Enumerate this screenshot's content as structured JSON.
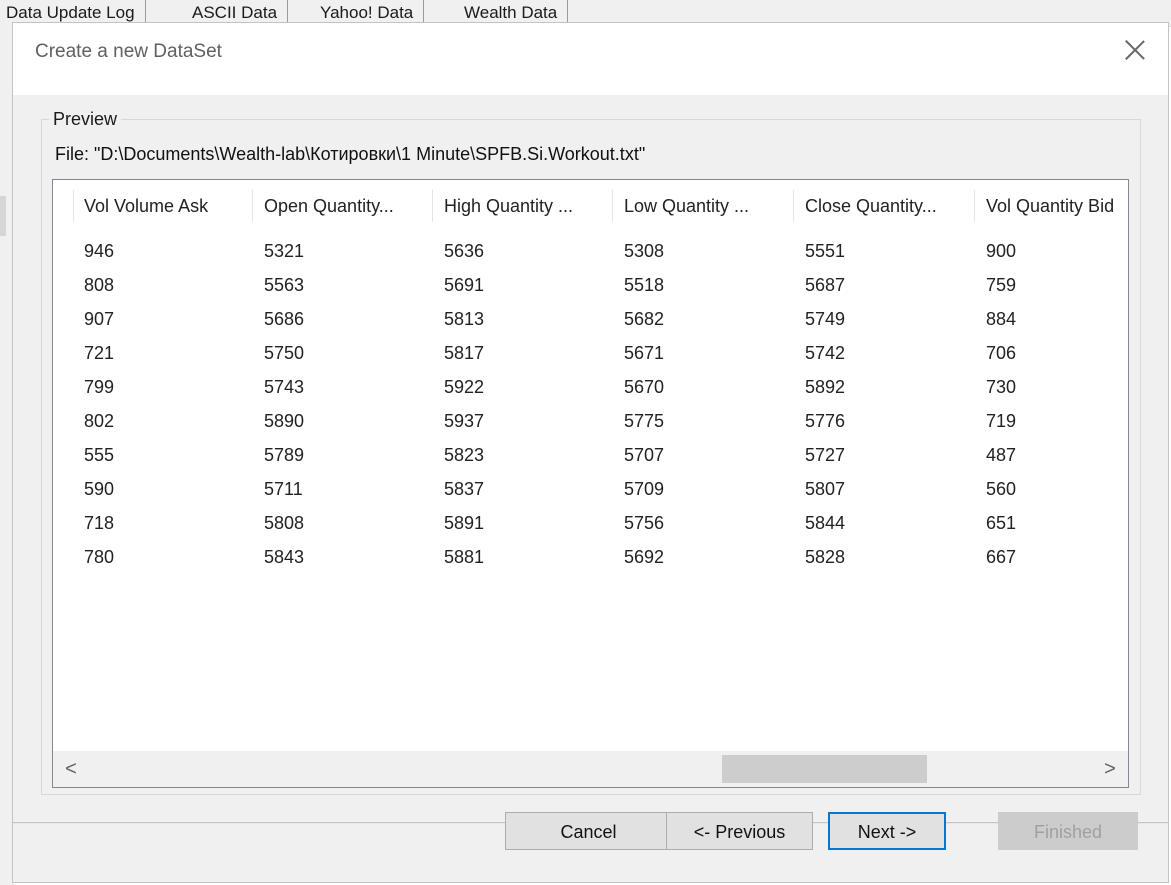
{
  "background_tabs": [
    "Data Update Log",
    "ASCII Data",
    "Yahoo! Data",
    "Wealth Data"
  ],
  "dialog": {
    "title": "Create a new DataSet",
    "close_label": "✕"
  },
  "preview": {
    "group_label": "Preview",
    "file_label": "File: \"D:\\Documents\\Wealth-lab\\Котировки\\1 Minute\\SPFB.Si.Workout.txt\""
  },
  "table": {
    "columns": [
      "Vol Volume Ask",
      "Open Quantity...",
      "High Quantity ...",
      "Low Quantity ...",
      "Close Quantity...",
      "Vol Quantity Bid"
    ],
    "rows": [
      [
        "946",
        "5321",
        "5636",
        "5308",
        "5551",
        "900"
      ],
      [
        "808",
        "5563",
        "5691",
        "5518",
        "5687",
        "759"
      ],
      [
        "907",
        "5686",
        "5813",
        "5682",
        "5749",
        "884"
      ],
      [
        "721",
        "5750",
        "5817",
        "5671",
        "5742",
        "706"
      ],
      [
        "799",
        "5743",
        "5922",
        "5670",
        "5892",
        "730"
      ],
      [
        "802",
        "5890",
        "5937",
        "5775",
        "5776",
        "719"
      ],
      [
        "555",
        "5789",
        "5823",
        "5707",
        "5727",
        "487"
      ],
      [
        "590",
        "5711",
        "5837",
        "5709",
        "5807",
        "560"
      ],
      [
        "718",
        "5808",
        "5891",
        "5756",
        "5844",
        "651"
      ],
      [
        "780",
        "5843",
        "5881",
        "5692",
        "5828",
        "667"
      ]
    ],
    "scroll_left_glyph": "<",
    "scroll_right_glyph": ">"
  },
  "buttons": {
    "cancel": "Cancel",
    "previous": "<- Previous",
    "next": "Next ->",
    "finished": "Finished"
  },
  "colors": {
    "accent": "#0078d7",
    "dialog_bg": "#f0f0f0",
    "list_bg": "#ffffff"
  }
}
